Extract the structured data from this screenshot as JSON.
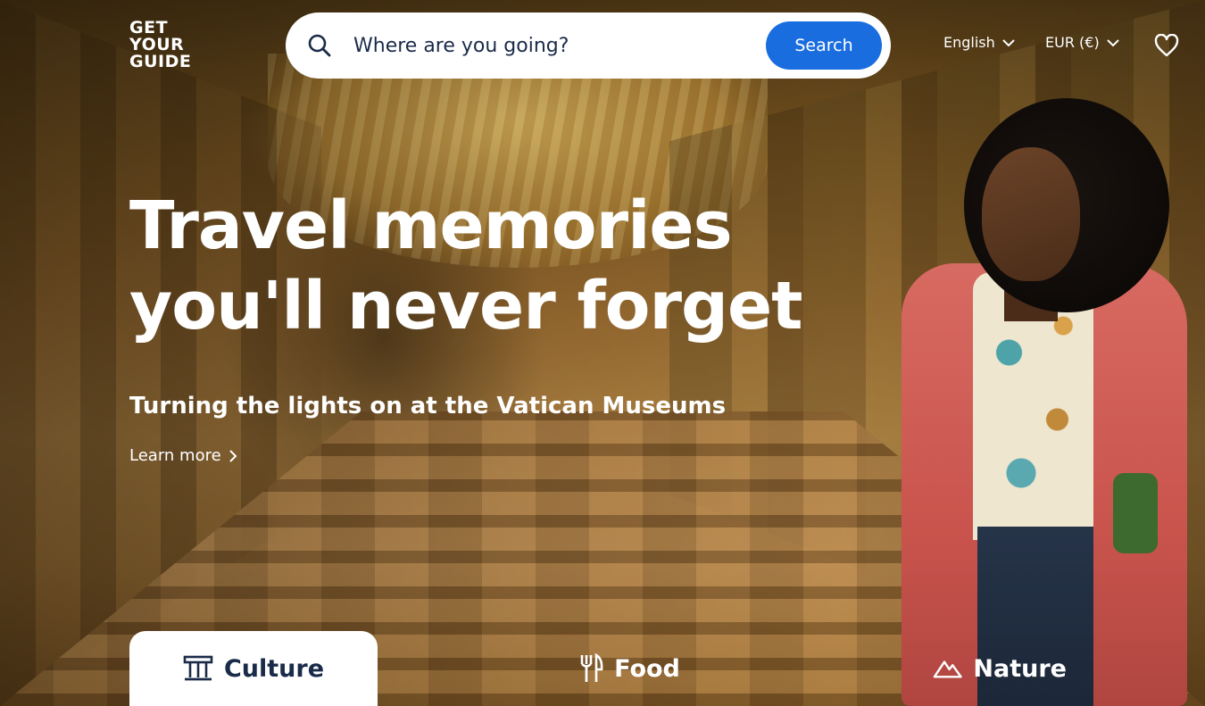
{
  "header": {
    "logo_lines": [
      "GET",
      "YOUR",
      "GUIDE"
    ],
    "search": {
      "placeholder": "Where are you going?",
      "button_label": "Search",
      "icon": "search-icon"
    },
    "language": "English",
    "currency": "EUR (€)",
    "wishlist_icon": "heart-icon"
  },
  "hero": {
    "headline_line1": "Travel memories",
    "headline_line2": "you'll never forget",
    "subheading": "Turning the lights on at the Vatican Museums",
    "learn_more_label": "Learn more"
  },
  "categories": [
    {
      "label": "Culture",
      "icon": "museum-icon",
      "selected": true
    },
    {
      "label": "Food",
      "icon": "fork-knife-icon",
      "selected": false
    },
    {
      "label": "Nature",
      "icon": "mountain-icon",
      "selected": false
    }
  ],
  "colors": {
    "accent": "#1a6ddf",
    "text_dark": "#1a2b49",
    "white": "#ffffff"
  }
}
